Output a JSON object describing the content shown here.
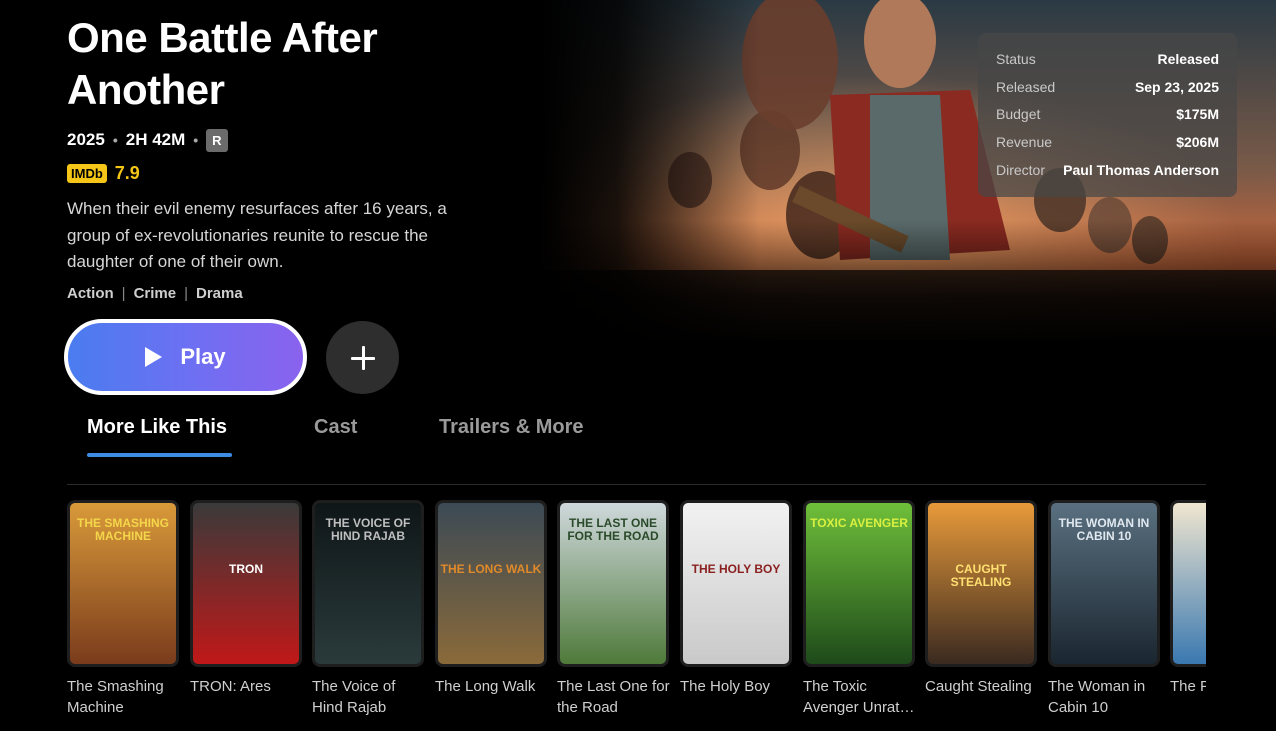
{
  "movie": {
    "title": "One Battle After Another",
    "year": "2025",
    "runtime": "2H 42M",
    "rating": "R",
    "imdb_label": "IMDb",
    "imdb_score": "7.9",
    "synopsis": "When their evil enemy resurfaces after 16 years, a group of ex-revolutionaries reunite to rescue the daughter of one of their own.",
    "genres": [
      "Action",
      "Crime",
      "Drama"
    ],
    "genre_separator": "|"
  },
  "info_card": [
    {
      "label": "Status",
      "value": "Released"
    },
    {
      "label": "Released",
      "value": "Sep 23, 2025"
    },
    {
      "label": "Budget",
      "value": "$175M"
    },
    {
      "label": "Revenue",
      "value": "$206M"
    },
    {
      "label": "Director",
      "value": "Paul Thomas Anderson"
    }
  ],
  "actions": {
    "play_label": "Play",
    "play_icon": "play-icon",
    "add_icon": "plus-icon"
  },
  "tabs": [
    {
      "label": "More Like This",
      "active": true
    },
    {
      "label": "Cast",
      "active": false
    },
    {
      "label": "Trailers & More",
      "active": false
    }
  ],
  "posters": [
    {
      "label": "The Smashing Machine",
      "art_text": "THE SMASHING MACHINE",
      "colors": [
        "#d99a3a",
        "#7a3b1c"
      ],
      "text_color": "#f3d64a"
    },
    {
      "label": "TRON: Ares",
      "art_text": "TRON",
      "colors": [
        "#3a3a3a",
        "#c01818"
      ],
      "text_color": "#ffffff"
    },
    {
      "label": "The Voice of Hind Rajab",
      "art_text": "THE VOICE OF HIND RAJAB",
      "colors": [
        "#0f1618",
        "#2a3a3a"
      ],
      "text_color": "#bfbfbf"
    },
    {
      "label": "The Long Walk",
      "art_text": "THE LONG WALK",
      "colors": [
        "#3c4a55",
        "#8a6a3a"
      ],
      "text_color": "#e08a2a"
    },
    {
      "label": "The Last One for the Road",
      "art_text": "THE LAST ONE FOR THE ROAD",
      "colors": [
        "#cfd8dc",
        "#4f7a3a"
      ],
      "text_color": "#2a4a2a"
    },
    {
      "label": "The Holy Boy",
      "art_text": "THE HOLY BOY",
      "colors": [
        "#f2f2f2",
        "#c9c9c9"
      ],
      "text_color": "#8a2020"
    },
    {
      "label": "The Toxic Avenger Unrat…",
      "art_text": "TOXIC AVENGER",
      "colors": [
        "#6fbf3a",
        "#1e4a1a"
      ],
      "text_color": "#d8f040"
    },
    {
      "label": "Caught Stealing",
      "art_text": "CAUGHT STEALING",
      "colors": [
        "#e89a3a",
        "#3a2a20"
      ],
      "text_color": "#ffe070"
    },
    {
      "label": "The Woman in Cabin 10",
      "art_text": "THE WOMAN IN CABIN 10",
      "colors": [
        "#5a7080",
        "#1a2630"
      ],
      "text_color": "#e0e8f0"
    },
    {
      "label": "The F… First…",
      "art_text": "",
      "colors": [
        "#f0e6d0",
        "#3a78b0"
      ],
      "text_color": "#ffffff"
    }
  ]
}
